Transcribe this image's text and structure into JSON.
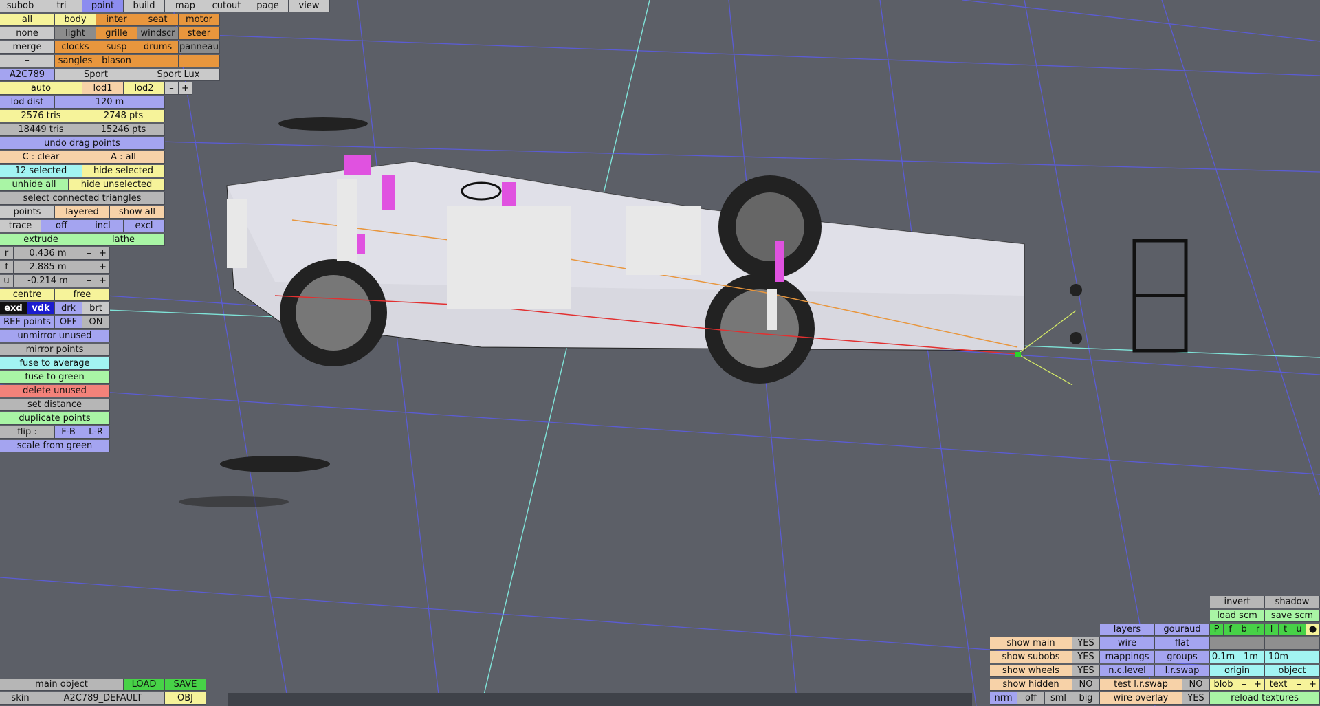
{
  "tabs": [
    "subob",
    "tri",
    "point",
    "build",
    "map",
    "cutout",
    "page",
    "view"
  ],
  "sel_buttons": [
    "all",
    "none",
    "merge",
    "–"
  ],
  "parts": [
    [
      "body",
      "inter",
      "seat",
      "motor"
    ],
    [
      "light",
      "grille",
      "windscr",
      "steer"
    ],
    [
      "clocks",
      "susp",
      "drums",
      "panneau"
    ],
    [
      "sangles",
      "blason",
      "",
      ""
    ]
  ],
  "model": {
    "code": "A2C789",
    "variants": [
      "Sport",
      "Sport Lux"
    ]
  },
  "lod": {
    "auto": "auto",
    "lod1": "lod1",
    "lod2": "lod2",
    "minus": "–",
    "plus": "+",
    "dist_label": "lod dist",
    "dist_value": "120 m"
  },
  "stats": {
    "tris1": "2576 tris",
    "pts1": "2748 pts",
    "tris2": "18449 tris",
    "pts2": "15246 pts"
  },
  "edit": {
    "undo": "undo drag points",
    "clear": "C : clear",
    "all": "A : all",
    "selected": "12 selected",
    "hide_selected": "hide selected",
    "unhide_all": "unhide all",
    "hide_unselected": "hide unselected",
    "select_connected": "select connected triangles"
  },
  "points_mode": {
    "label": "points",
    "layered": "layered",
    "show_all": "show all"
  },
  "trace": {
    "label": "trace",
    "off": "off",
    "incl": "incl",
    "excl": "excl"
  },
  "extrude": {
    "extrude": "extrude",
    "lathe": "lathe"
  },
  "coords": [
    {
      "axis": "r",
      "value": "0.436 m"
    },
    {
      "axis": "f",
      "value": "2.885 m"
    },
    {
      "axis": "u",
      "value": "-0.214 m"
    }
  ],
  "stepper": {
    "minus": "–",
    "plus": "+"
  },
  "centre": {
    "centre": "centre",
    "free": "free"
  },
  "view_modes": [
    "exd",
    "vdk",
    "drk",
    "brt"
  ],
  "ref_points": {
    "label": "REF points",
    "off": "OFF",
    "on": "ON"
  },
  "actions": {
    "unmirror": "unmirror unused",
    "mirror": "mirror points",
    "fuse_avg": "fuse to average",
    "fuse_green": "fuse to green",
    "delete_unused": "delete unused",
    "set_distance": "set distance",
    "duplicate": "duplicate points",
    "flip_label": "flip :",
    "flip_fb": "F-B",
    "flip_lr": "L-R",
    "scale_green": "scale from green"
  },
  "object": {
    "main_label": "main object",
    "load": "LOAD",
    "save": "SAVE",
    "skin_label": "skin",
    "skin_value": "A2C789_DEFAULT",
    "obj": "OBJ"
  },
  "show": [
    {
      "label": "show main",
      "value": "YES"
    },
    {
      "label": "show subobs",
      "value": "YES"
    },
    {
      "label": "show wheels",
      "value": "YES"
    },
    {
      "label": "show hidden",
      "value": "NO"
    }
  ],
  "render": {
    "layers": "layers",
    "gouraud": "gouraud",
    "wire": "wire",
    "flat": "flat",
    "mappings": "mappings",
    "groups": "groups",
    "nc_level": "n.c.level",
    "lr_swap": "l.r.swap",
    "test_lr_swap": "test l.r.swap",
    "no": "NO",
    "wire_overlay": "wire overlay",
    "yes": "YES",
    "nrm": "nrm",
    "off": "off",
    "sml": "sml",
    "big": "big"
  },
  "right": {
    "invert": "invert",
    "shadow": "shadow",
    "load_scm": "load scm",
    "save_scm": "save scm",
    "views": [
      "P",
      "f",
      "b",
      "r",
      "l",
      "t",
      "u"
    ],
    "dot": "●",
    "dash1": "–",
    "dash2": "–",
    "grid": [
      "0.1m",
      "1m",
      "10m"
    ],
    "grid_minus": "–",
    "origin": "origin",
    "object": "object",
    "blob": "blob",
    "text": "text",
    "reload": "reload textures"
  },
  "colors": {
    "background": "#5c5f67",
    "grid": "#5b5ce8",
    "axis_cyan": "#7fe3d8",
    "selected_point": "#e052e0",
    "point": "#e8e8e8",
    "body": "#d8d8e0"
  }
}
